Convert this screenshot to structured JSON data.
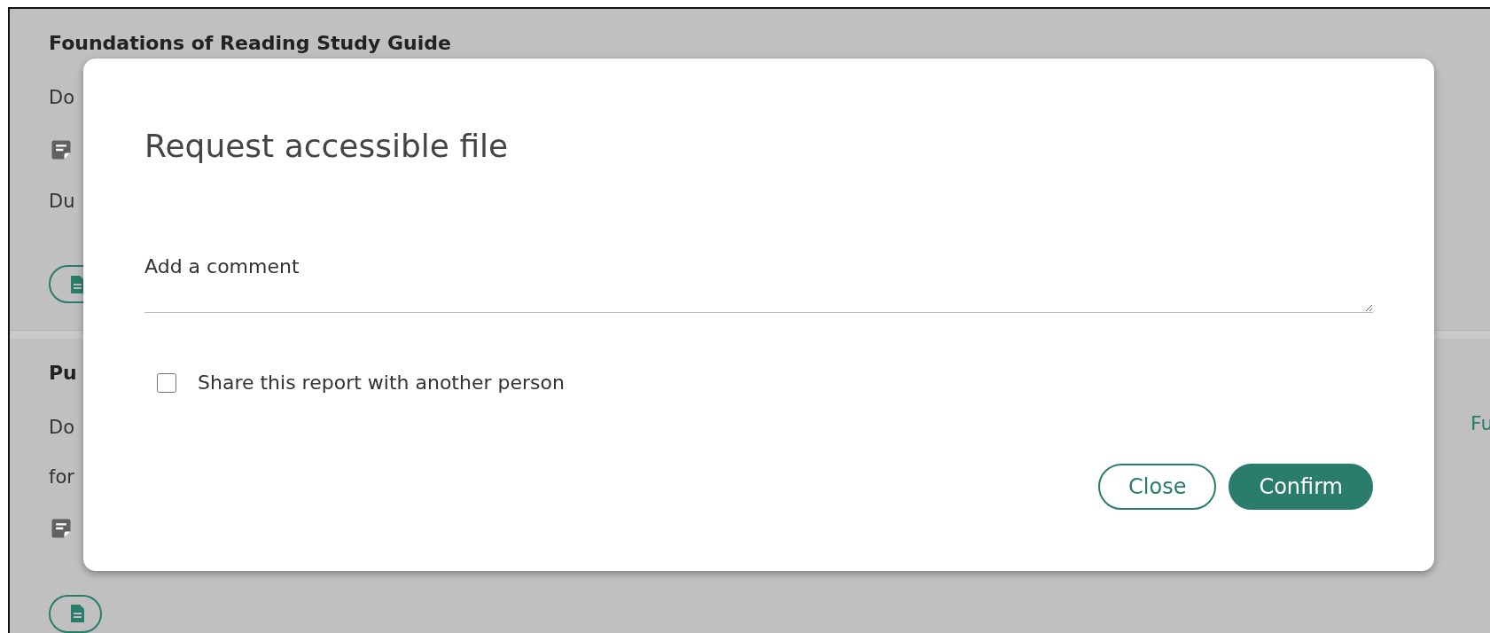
{
  "background": {
    "rows": [
      {
        "kind": "title",
        "text": "Foundations of Reading Study Guide"
      },
      {
        "kind": "text",
        "text": "Do"
      },
      {
        "kind": "icon"
      },
      {
        "kind": "text",
        "text": "Du"
      },
      {
        "kind": "pill"
      },
      {
        "kind": "divider"
      },
      {
        "kind": "title",
        "text": "Pu"
      },
      {
        "kind": "text",
        "text": "Do"
      },
      {
        "kind": "text",
        "text": "for"
      },
      {
        "kind": "icon"
      },
      {
        "kind": "pill"
      }
    ],
    "side_link": "Fu"
  },
  "modal": {
    "title": "Request accessible file",
    "comment": {
      "placeholder": "Add a comment"
    },
    "checkbox": {
      "label": "Share this report with another person",
      "checked": false
    },
    "buttons": [
      {
        "label": "Close",
        "kind": "secondary"
      },
      {
        "label": "Confirm",
        "kind": "primary"
      }
    ]
  }
}
